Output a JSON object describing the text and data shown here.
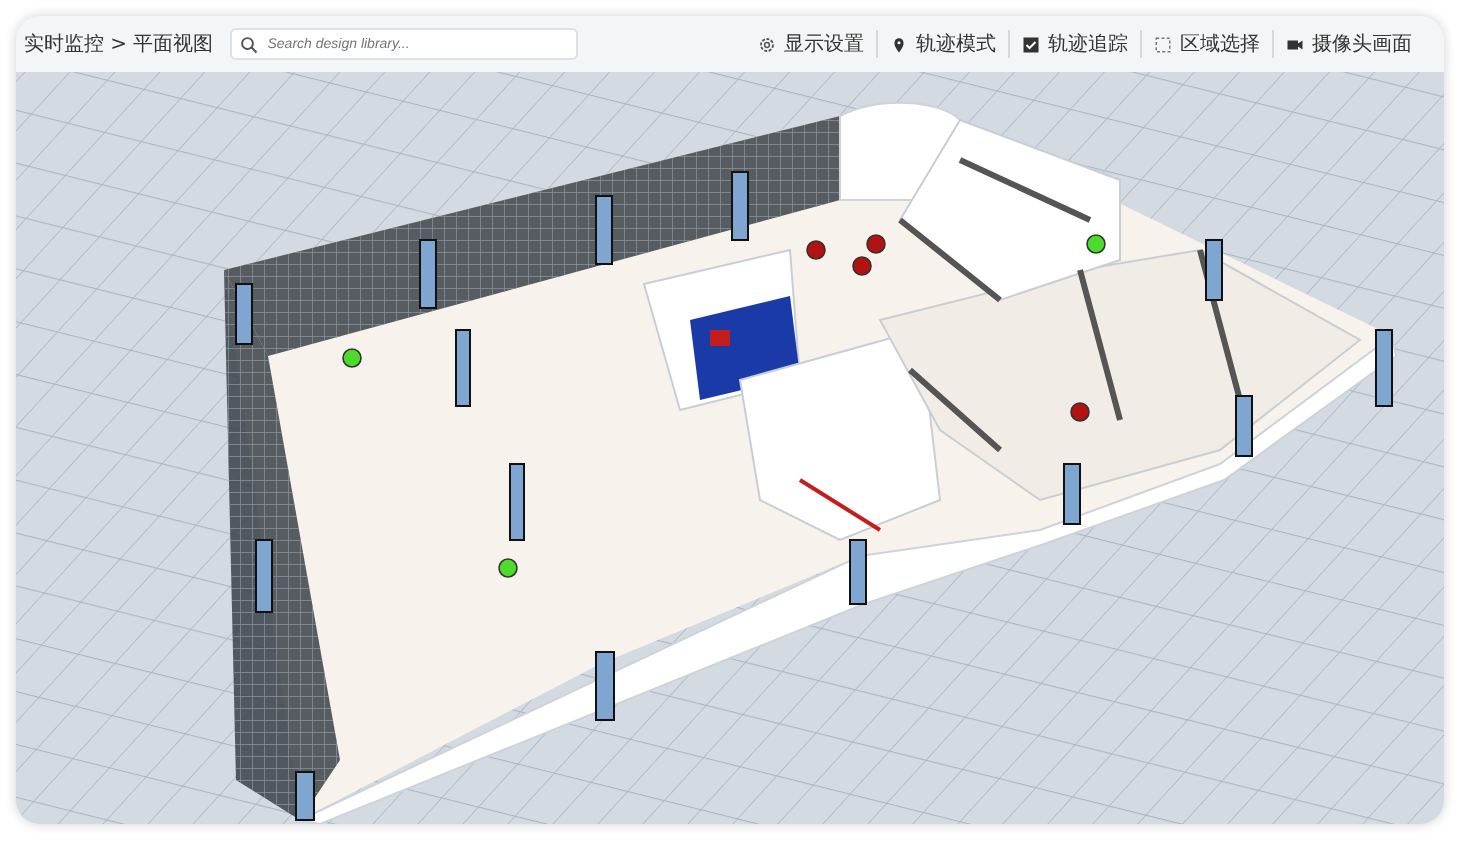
{
  "breadcrumb": "实时监控 > 平面视图",
  "search": {
    "placeholder": "Search design library..."
  },
  "toolbar": [
    {
      "label": "显示设置"
    },
    {
      "label": "轨迹模式"
    },
    {
      "label": "轨迹追踪"
    },
    {
      "label": "区域选择"
    },
    {
      "label": "摄像头画面"
    }
  ]
}
